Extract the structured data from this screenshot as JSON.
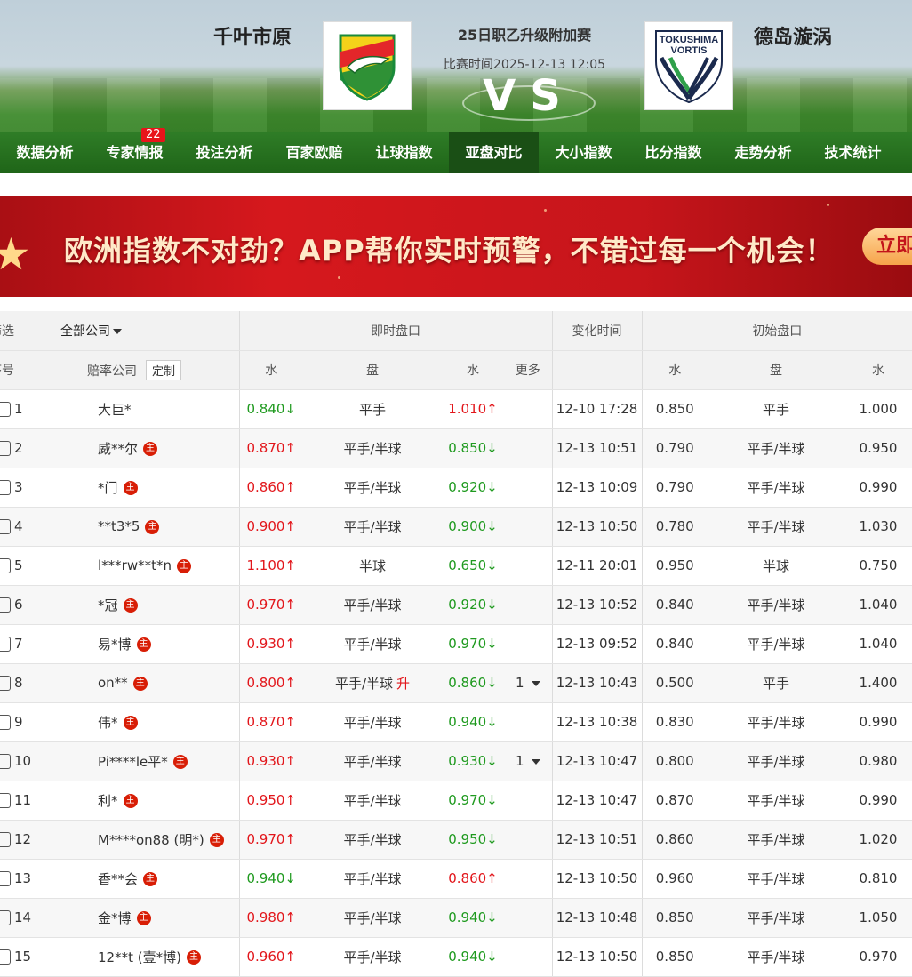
{
  "header": {
    "home_team": "千叶市原",
    "away_team": "德岛漩涡",
    "competition": "25日职乙升级附加赛",
    "match_time": "比赛时间2025-12-13 12:05",
    "vs": "VS",
    "away_logo_text_1": "TOKUSHIMA",
    "away_logo_text_2": "VORTIS"
  },
  "nav": {
    "items": [
      {
        "label": "数据分析"
      },
      {
        "label": "专家情报",
        "badge": "22"
      },
      {
        "label": "投注分析"
      },
      {
        "label": "百家欧赔"
      },
      {
        "label": "让球指数"
      },
      {
        "label": "亚盘对比",
        "active": true
      },
      {
        "label": "大小指数"
      },
      {
        "label": "比分指数"
      },
      {
        "label": "走势分析"
      },
      {
        "label": "技术统计"
      }
    ]
  },
  "banner": {
    "text": "欧洲指数不对劲？APP帮你实时预警，不错过每一个机会！",
    "button": "立即"
  },
  "table": {
    "header1": {
      "filter": "筛选",
      "all_companies": "全部公司",
      "live": "即时盘口",
      "change_time": "变化时间",
      "initial": "初始盘口"
    },
    "header2": {
      "seq": "序号",
      "company": "赔率公司",
      "customize": "定制",
      "water1": "水",
      "handicap": "盘",
      "water2": "水",
      "more": "更多",
      "init_water1": "水",
      "init_handicap": "盘",
      "init_water2": "水"
    },
    "rows": [
      {
        "seq": "1",
        "company": "大巨*",
        "zhu": false,
        "w1": "0.840↓",
        "w1dir": "down",
        "pan": "平手",
        "rise": "",
        "w2": "1.010↑",
        "w2dir": "up",
        "more": "",
        "time": "12-10 17:28",
        "iw1": "0.850",
        "ipan": "平手",
        "iw2": "1.000"
      },
      {
        "seq": "2",
        "company": "威**尔",
        "zhu": true,
        "w1": "0.870↑",
        "w1dir": "up",
        "pan": "平手/半球",
        "rise": "",
        "w2": "0.850↓",
        "w2dir": "down",
        "more": "",
        "time": "12-13 10:51",
        "iw1": "0.790",
        "ipan": "平手/半球",
        "iw2": "0.950"
      },
      {
        "seq": "3",
        "company": "*门",
        "zhu": true,
        "w1": "0.860↑",
        "w1dir": "up",
        "pan": "平手/半球",
        "rise": "",
        "w2": "0.920↓",
        "w2dir": "down",
        "more": "",
        "time": "12-13 10:09",
        "iw1": "0.790",
        "ipan": "平手/半球",
        "iw2": "0.990"
      },
      {
        "seq": "4",
        "company": "**t3*5",
        "zhu": true,
        "w1": "0.900↑",
        "w1dir": "up",
        "pan": "平手/半球",
        "rise": "",
        "w2": "0.900↓",
        "w2dir": "down",
        "more": "",
        "time": "12-13 10:50",
        "iw1": "0.780",
        "ipan": "平手/半球",
        "iw2": "1.030"
      },
      {
        "seq": "5",
        "company": "l***rw**t*n",
        "zhu": true,
        "w1": "1.100↑",
        "w1dir": "up",
        "pan": "半球",
        "rise": "",
        "w2": "0.650↓",
        "w2dir": "down",
        "more": "",
        "time": "12-11 20:01",
        "iw1": "0.950",
        "ipan": "半球",
        "iw2": "0.750"
      },
      {
        "seq": "6",
        "company": "*冠",
        "zhu": true,
        "w1": "0.970↑",
        "w1dir": "up",
        "pan": "平手/半球",
        "rise": "",
        "w2": "0.920↓",
        "w2dir": "down",
        "more": "",
        "time": "12-13 10:52",
        "iw1": "0.840",
        "ipan": "平手/半球",
        "iw2": "1.040"
      },
      {
        "seq": "7",
        "company": "易*博",
        "zhu": true,
        "w1": "0.930↑",
        "w1dir": "up",
        "pan": "平手/半球",
        "rise": "",
        "w2": "0.970↓",
        "w2dir": "down",
        "more": "",
        "time": "12-13 09:52",
        "iw1": "0.840",
        "ipan": "平手/半球",
        "iw2": "1.040"
      },
      {
        "seq": "8",
        "company": "on**",
        "zhu": true,
        "w1": "0.800↑",
        "w1dir": "up",
        "pan": "平手/半球",
        "rise": "升",
        "w2": "0.860↓",
        "w2dir": "down",
        "more": "1",
        "time": "12-13 10:43",
        "iw1": "0.500",
        "ipan": "平手",
        "iw2": "1.400"
      },
      {
        "seq": "9",
        "company": "伟*",
        "zhu": true,
        "w1": "0.870↑",
        "w1dir": "up",
        "pan": "平手/半球",
        "rise": "",
        "w2": "0.940↓",
        "w2dir": "down",
        "more": "",
        "time": "12-13 10:38",
        "iw1": "0.830",
        "ipan": "平手/半球",
        "iw2": "0.990"
      },
      {
        "seq": "10",
        "company": "Pi****le平*",
        "zhu": true,
        "w1": "0.930↑",
        "w1dir": "up",
        "pan": "平手/半球",
        "rise": "",
        "w2": "0.930↓",
        "w2dir": "down",
        "more": "1",
        "time": "12-13 10:47",
        "iw1": "0.800",
        "ipan": "平手/半球",
        "iw2": "0.980"
      },
      {
        "seq": "11",
        "company": "利*",
        "zhu": true,
        "w1": "0.950↑",
        "w1dir": "up",
        "pan": "平手/半球",
        "rise": "",
        "w2": "0.970↓",
        "w2dir": "down",
        "more": "",
        "time": "12-13 10:47",
        "iw1": "0.870",
        "ipan": "平手/半球",
        "iw2": "0.990"
      },
      {
        "seq": "12",
        "company": "M****on88 (明*)",
        "zhu": true,
        "w1": "0.970↑",
        "w1dir": "up",
        "pan": "平手/半球",
        "rise": "",
        "w2": "0.950↓",
        "w2dir": "down",
        "more": "",
        "time": "12-13 10:51",
        "iw1": "0.860",
        "ipan": "平手/半球",
        "iw2": "1.020"
      },
      {
        "seq": "13",
        "company": "香**会",
        "zhu": true,
        "w1": "0.940↓",
        "w1dir": "down",
        "pan": "平手/半球",
        "rise": "",
        "w2": "0.860↑",
        "w2dir": "up",
        "more": "",
        "time": "12-13 10:50",
        "iw1": "0.960",
        "ipan": "平手/半球",
        "iw2": "0.810"
      },
      {
        "seq": "14",
        "company": "金*博",
        "zhu": true,
        "w1": "0.980↑",
        "w1dir": "up",
        "pan": "平手/半球",
        "rise": "",
        "w2": "0.940↓",
        "w2dir": "down",
        "more": "",
        "time": "12-13 10:48",
        "iw1": "0.850",
        "ipan": "平手/半球",
        "iw2": "1.050"
      },
      {
        "seq": "15",
        "company": "12**t (壹*博)",
        "zhu": true,
        "w1": "0.960↑",
        "w1dir": "up",
        "pan": "平手/半球",
        "rise": "",
        "w2": "0.940↓",
        "w2dir": "down",
        "more": "",
        "time": "12-13 10:50",
        "iw1": "0.850",
        "ipan": "平手/半球",
        "iw2": "0.970"
      }
    ],
    "zhu_label": "主"
  },
  "colors": {
    "nav_green": "#2f7d27",
    "nav_active": "#1a4f15",
    "up_red": "#e2161b",
    "down_green": "#1f9a1f",
    "badge_red": "#e8141a",
    "banner_red": "#d6181d"
  }
}
